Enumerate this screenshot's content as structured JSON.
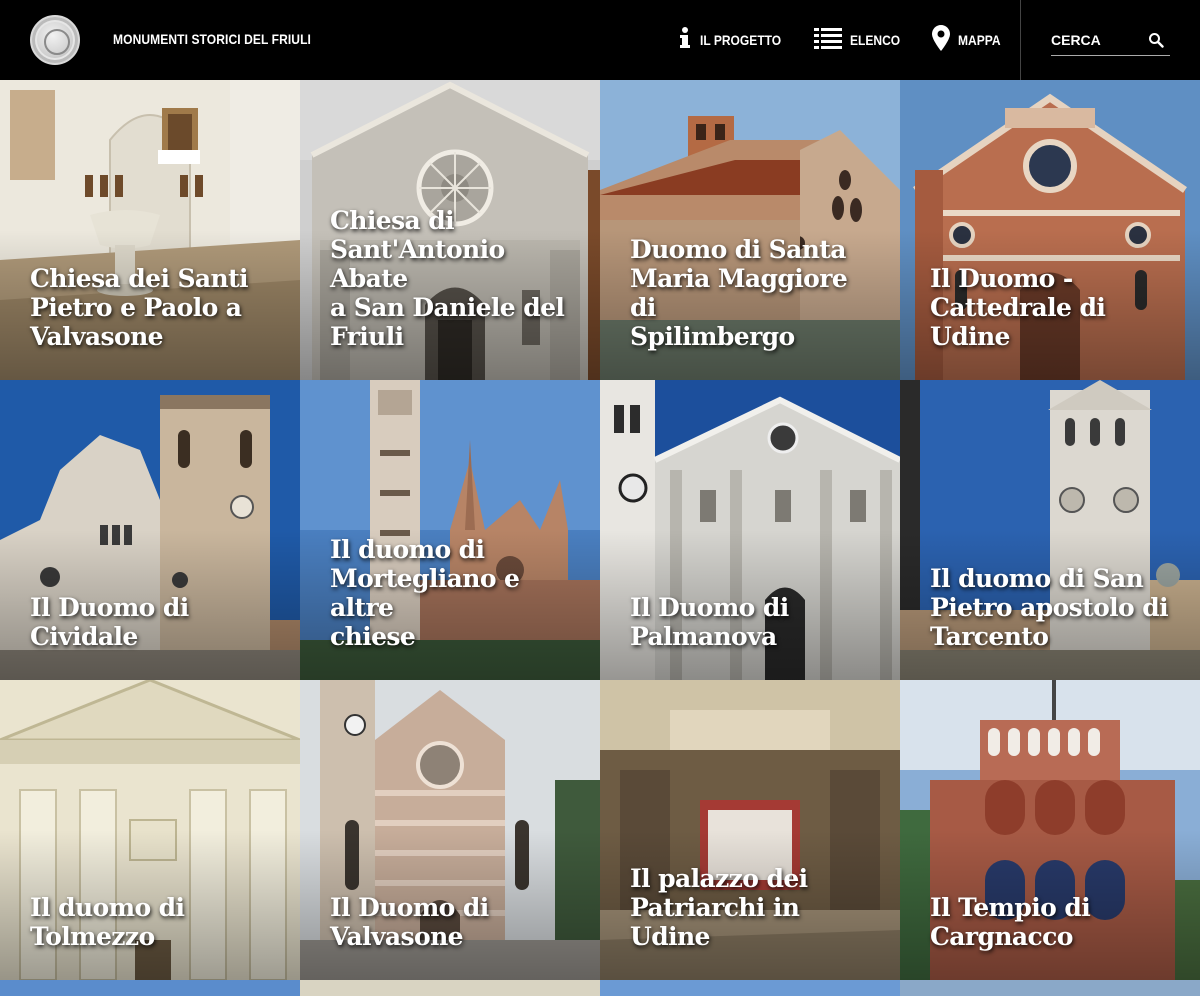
{
  "header": {
    "site_title": "MONUMENTI STORICI DEL FRIULI",
    "nav": [
      {
        "label": "IL PROGETTO",
        "icon": "info-icon"
      },
      {
        "label": "ELENCO",
        "icon": "list-icon"
      },
      {
        "label": "MAPPA",
        "icon": "map-pin-icon"
      }
    ],
    "search": {
      "placeholder": "CERCA",
      "icon": "search-icon"
    }
  },
  "tiles": [
    {
      "title": "Chiesa dei Santi\nPietro e Paolo a\nValvasone"
    },
    {
      "title": "Chiesa di\nSant'Antonio Abate\na San Daniele del\nFriuli"
    },
    {
      "title": "Duomo di Santa\nMaria Maggiore di\nSpilimbergo"
    },
    {
      "title": "Il Duomo -\nCattedrale di Udine"
    },
    {
      "title": "Il Duomo di\nCividale"
    },
    {
      "title": "Il duomo di\nMortegliano e altre\nchiese"
    },
    {
      "title": "Il Duomo di\nPalmanova"
    },
    {
      "title": "Il duomo di San\nPietro apostolo di\nTarcento"
    },
    {
      "title": "Il duomo di\nTolmezzo"
    },
    {
      "title": "Il Duomo di\nValvasone"
    },
    {
      "title": "Il palazzo dei\nPatriarchi in Udine"
    },
    {
      "title": "Il Tempio di\nCargnacco"
    }
  ],
  "colors": {
    "header_bg": "#000000",
    "text": "#ffffff"
  }
}
